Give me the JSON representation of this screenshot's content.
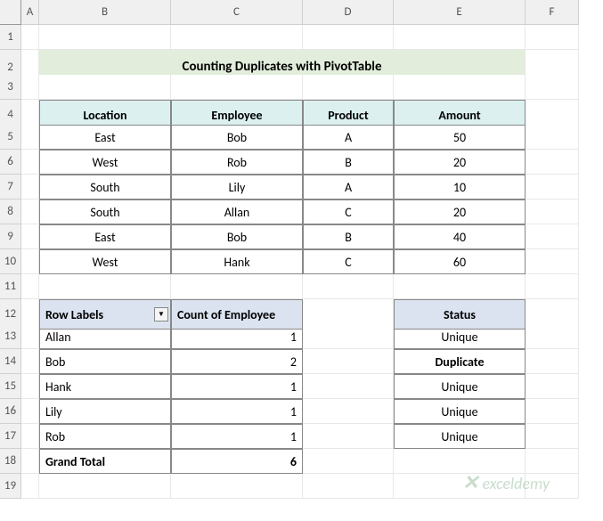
{
  "columns": [
    "A",
    "B",
    "C",
    "D",
    "E",
    "F"
  ],
  "title": "Counting Duplicates with PivotTable",
  "table1": {
    "headers": [
      "Location",
      "Employee",
      "Product",
      "Amount"
    ],
    "rows": [
      {
        "location": "East",
        "employee": "Bob",
        "product": "A",
        "amount": "50"
      },
      {
        "location": "West",
        "employee": "Rob",
        "product": "B",
        "amount": "20"
      },
      {
        "location": "South",
        "employee": "Lily",
        "product": "A",
        "amount": "10"
      },
      {
        "location": "South",
        "employee": "Allan",
        "product": "C",
        "amount": "20"
      },
      {
        "location": "East",
        "employee": "Bob",
        "product": "B",
        "amount": "40"
      },
      {
        "location": "West",
        "employee": "Hank",
        "product": "C",
        "amount": "60"
      }
    ]
  },
  "pivot": {
    "rowLabelsHdr": "Row Labels",
    "countHdr": "Count of Employee",
    "statusHdr": "Status",
    "rows": [
      {
        "name": "Allan",
        "count": "1",
        "status": "Unique"
      },
      {
        "name": "Bob",
        "count": "2",
        "status": "Duplicate"
      },
      {
        "name": "Hank",
        "count": "1",
        "status": "Unique"
      },
      {
        "name": "Lily",
        "count": "1",
        "status": "Unique"
      },
      {
        "name": "Rob",
        "count": "1",
        "status": "Unique"
      }
    ],
    "grandTotalLabel": "Grand Total",
    "grandTotalValue": "6"
  },
  "watermark": "exceldemy"
}
